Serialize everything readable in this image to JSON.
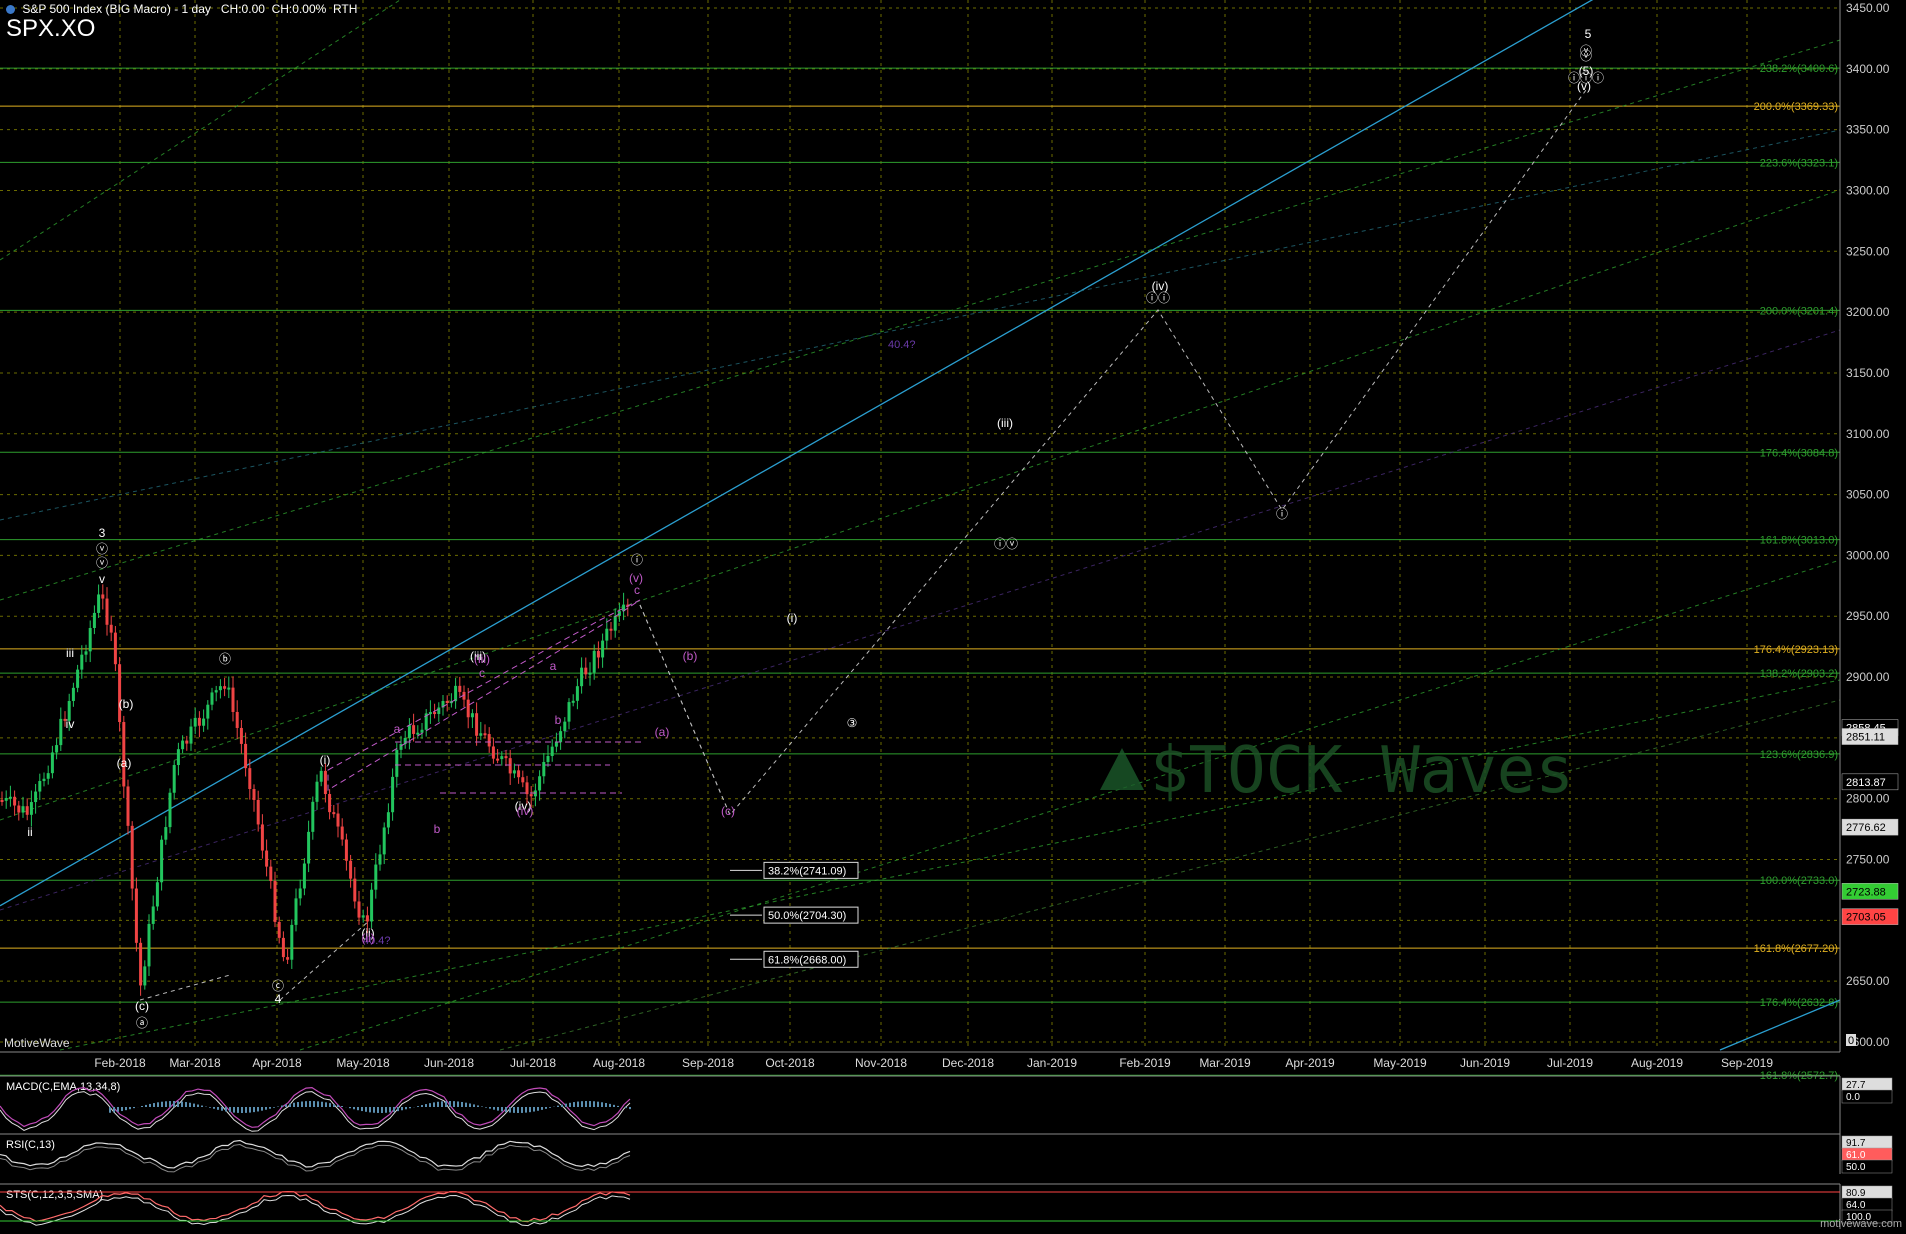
{
  "header": {
    "title": "S&P 500 Index (BIG Macro) - 1 day",
    "change": "CH:0.00",
    "change_pct": "CH:0.00%",
    "session": "RTH",
    "symbol": "SPX.XO"
  },
  "brand": "MotiveWave",
  "watermark": "$TOCK Waves",
  "site": "motivewave.com",
  "colors": {
    "background": "#000000",
    "grid": "#6b6b00",
    "up_candle": "#22c55e",
    "down_candle": "#ef4444",
    "fib_green": "#2e9e2e",
    "fib_yellow": "#e0b020",
    "trend_cyan": "#2b9fd0",
    "wave_white": "#ffffff",
    "wave_magenta": "#c05ac8"
  },
  "chart_data": [
    {
      "type": "candlestick",
      "title": "S&P 500 Index (BIG Macro) - 1 day",
      "ylim": [
        2500,
        3460
      ],
      "y_ticks": [
        2600,
        2650,
        2700,
        2750,
        2800,
        2850,
        2900,
        2950,
        3000,
        3050,
        3100,
        3150,
        3200,
        3250,
        3300,
        3350,
        3400,
        3450
      ],
      "y_tick_labels": [
        "2600.00",
        "2650.00",
        "2700.00",
        "2750.00",
        "2800.00",
        "2850.00",
        "2900.00",
        "2950.00",
        "3000.00",
        "3050.00",
        "3100.00",
        "3150.00",
        "3200.00",
        "3250.00",
        "3300.00",
        "3350.00",
        "3400.00",
        "3450.00"
      ],
      "x_labels": [
        "Feb-2018",
        "Mar-2018",
        "Apr-2018",
        "May-2018",
        "Jun-2018",
        "Jul-2018",
        "Aug-2018",
        "Sep-2018",
        "Oct-2018",
        "Nov-2018",
        "Dec-2018",
        "Jan-2019",
        "Feb-2019",
        "Mar-2019",
        "Apr-2019",
        "May-2019",
        "Jun-2019",
        "Jul-2019",
        "Aug-2019",
        "Sep-2019"
      ],
      "price_markers": [
        {
          "label": "2858.45",
          "value": 2858.45,
          "color": "#000000"
        },
        {
          "label": "2851.11",
          "value": 2851.11,
          "color": "#dddddd"
        },
        {
          "label": "2813.87",
          "value": 2813.87,
          "color": "#000000"
        },
        {
          "label": "2776.62",
          "value": 2776.62,
          "color": "#dddddd"
        },
        {
          "label": "2723.88",
          "value": 2723.88,
          "color": "#33cc33"
        },
        {
          "label": "2703.05",
          "value": 2703.05,
          "color": "#ff4444"
        }
      ],
      "fib_levels": [
        {
          "label": "238.2%(3400.6)",
          "value": 3400.6,
          "color": "#2e9e2e"
        },
        {
          "label": "200.0%(3369.33)",
          "value": 3369.33,
          "color": "#e0b020"
        },
        {
          "label": "223.6%(3323.1)",
          "value": 3323.1,
          "color": "#2e9e2e"
        },
        {
          "label": "200.0%(3201.4)",
          "value": 3201.4,
          "color": "#2e9e2e"
        },
        {
          "label": "176.4%(3084.8)",
          "value": 3084.8,
          "color": "#2e9e2e"
        },
        {
          "label": "161.8%(3013.0)",
          "value": 3013.0,
          "color": "#2e9e2e"
        },
        {
          "label": "176.4%(2923.13)",
          "value": 2923.13,
          "color": "#e0b020"
        },
        {
          "label": "138.2%(2903.2)",
          "value": 2903.2,
          "color": "#2e9e2e"
        },
        {
          "label": "123.6%(2836.9)",
          "value": 2836.9,
          "color": "#2e9e2e"
        },
        {
          "label": "100.0%(2733.0)",
          "value": 2733.0,
          "color": "#2e9e2e"
        },
        {
          "label": "161.8%(2677.20)",
          "value": 2677.2,
          "color": "#e0b020"
        },
        {
          "label": "176.4%(2632.8)",
          "value": 2632.8,
          "color": "#2e9e2e"
        },
        {
          "label": "161.8%(2572.7)",
          "value": 2572.7,
          "color": "#2e9e2e"
        }
      ],
      "retracement_boxes": [
        {
          "label": "38.2%(2741.09)",
          "value": 2741.09
        },
        {
          "label": "50.0%(2704.30)",
          "value": 2704.3
        },
        {
          "label": "61.8%(2668.00)",
          "value": 2668.0
        }
      ],
      "wave_labels_white": [
        "3",
        "ⓥ",
        "ⓥ",
        "v",
        "iii",
        "iv",
        "ii",
        "ⓑ",
        "(b)",
        "(a)",
        "(c)",
        "ⓐ",
        "ⓒ",
        "4",
        "(i)",
        "(ii)",
        "(iii)",
        "(iv)",
        "ⓘ",
        "(i)",
        "(iii)",
        "(iv)",
        "ⓘ",
        "ⓘⓘ",
        "ⓘⓥ",
        "ⓥ",
        "ⓘⓘⓘ",
        "(v)",
        "ⓥ",
        "(5)",
        "5",
        "③",
        "2 vs 1"
      ],
      "wave_labels_magenta": [
        "(iii)",
        "c",
        "a",
        "b",
        "a",
        "b",
        "(iv)",
        "(v)",
        "c",
        "(b)",
        "(a)",
        "(c)",
        "(ii)"
      ]
    },
    {
      "type": "line",
      "title": "MACD(C,EMA,13,34,8)",
      "y_tick_labels": [
        "27.7",
        "0.0"
      ]
    },
    {
      "type": "line",
      "title": "RSI(C,13)",
      "y_tick_labels": [
        "91.7",
        "61.0",
        "50.0"
      ]
    },
    {
      "type": "line",
      "title": "STS(C,12,3,5,SMA)",
      "y_tick_labels": [
        "80.9",
        "64.0",
        "100.0"
      ]
    }
  ]
}
